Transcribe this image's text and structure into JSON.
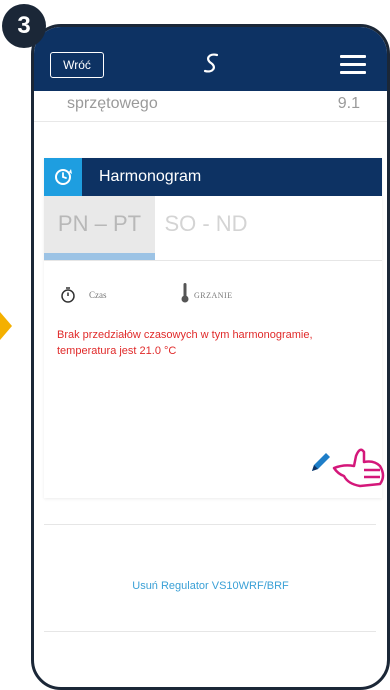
{
  "step_number": "3",
  "header": {
    "back_label": "Wróć",
    "logo_icon": "salus-logo-icon",
    "menu_icon": "hamburger-menu-icon"
  },
  "device_info": {
    "label": "sprzętowego",
    "value": "9.1"
  },
  "schedule": {
    "title": "Harmonogram",
    "tabs": [
      {
        "label": "PN – PT",
        "active": true
      },
      {
        "label": "SO - ND",
        "active": false
      }
    ],
    "columns": {
      "time": "Czas",
      "heat": "GRZANIE"
    },
    "message": "Brak przedziałów czasowych w tym harmonogramie, temperatura jest 21.0 °C"
  },
  "remove_link": "Usuń Regulator VS10WRF/BRF",
  "colors": {
    "header": "#0d3263",
    "accent": "#1e9ee0",
    "warning": "#e02a2a",
    "link": "#3aa0d6",
    "hand": "#d4177a"
  }
}
